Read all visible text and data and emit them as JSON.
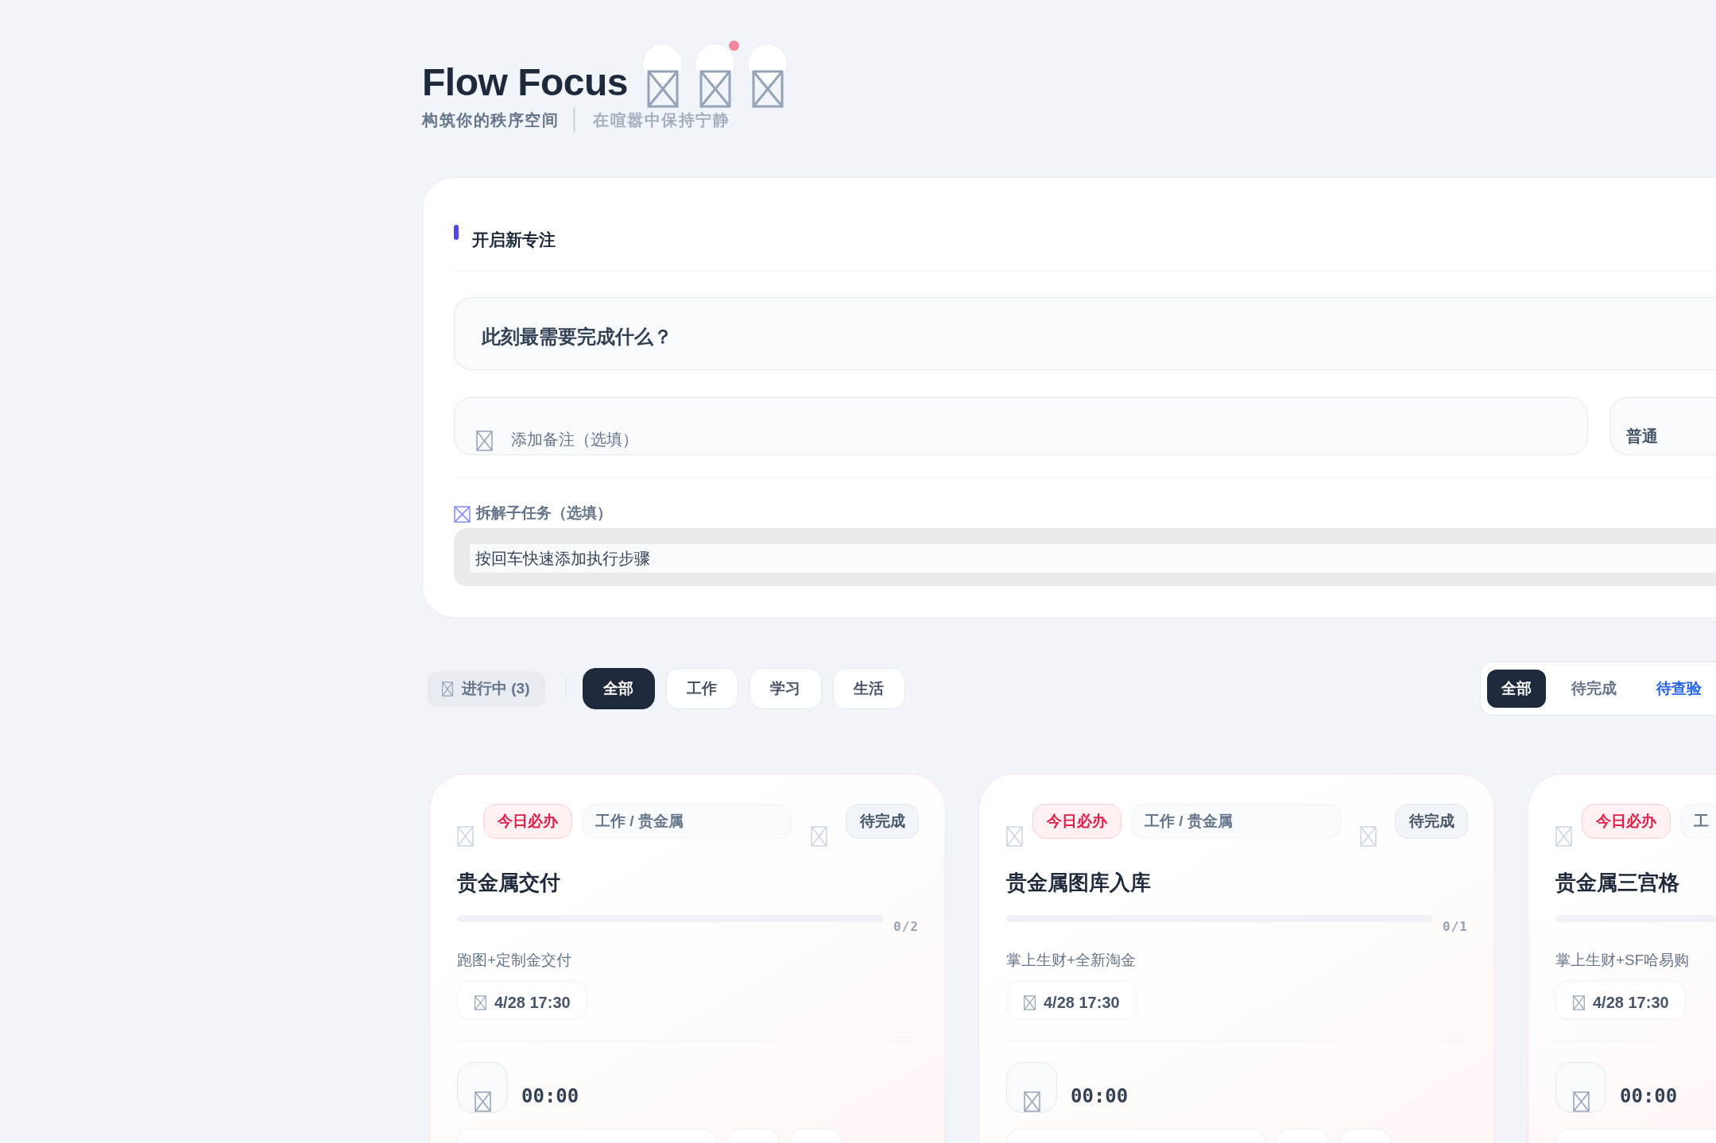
{
  "header": {
    "title": "Flow Focus",
    "tagline": "构筑你的秩序空间",
    "motto": "在喧嚣中保持宁静",
    "buttons": [
      {
        "notification": false
      },
      {
        "notification": true
      },
      {
        "notification": false
      }
    ]
  },
  "new_focus": {
    "heading": "开启新专注",
    "title_field": {
      "placeholder": "此刻最需要完成什么？"
    },
    "note_field": {
      "placeholder": "添加备注（选填）"
    },
    "priority": {
      "value": "普通"
    },
    "subtasks": {
      "label": "拆解子任务（选填）",
      "field": {
        "placeholder": "按回车快速添加执行步骤"
      }
    }
  },
  "filters": {
    "in_progress": {
      "label": "进行中 (3)"
    },
    "categories": [
      {
        "label": "全部",
        "selected": true
      },
      {
        "label": "工作",
        "selected": false
      },
      {
        "label": "学习",
        "selected": false
      },
      {
        "label": "生活",
        "selected": false
      }
    ],
    "statuses": [
      {
        "label": "全部",
        "selected": true,
        "color": "#1e293b"
      },
      {
        "label": "待完成",
        "selected": false,
        "color": "#64748b"
      },
      {
        "label": "待查验",
        "selected": false,
        "color": "#2563eb"
      }
    ]
  },
  "tasks": [
    {
      "badge": "今日必办",
      "tag": "工作 / 贵金属",
      "status": "待完成",
      "title": "贵金属交付",
      "progress": {
        "level": 0,
        "count": "0/2"
      },
      "note": "跑图+定制金交付",
      "due": "4/28 17:30",
      "timer": "00:00"
    },
    {
      "badge": "今日必办",
      "tag": "工作 / 贵金属",
      "status": "待完成",
      "title": "贵金属图库入库",
      "progress": {
        "level": 0,
        "count": "0/1"
      },
      "note": "掌上生财+全新淘金",
      "due": "4/28 17:30",
      "timer": "00:00"
    },
    {
      "badge": "今日必办",
      "tag": "工",
      "title": "贵金属三宫格",
      "progress": {
        "level": 0
      },
      "note": "掌上生财+SF哈易购",
      "due": "4/28 17:30",
      "timer": "00:00"
    }
  ]
}
